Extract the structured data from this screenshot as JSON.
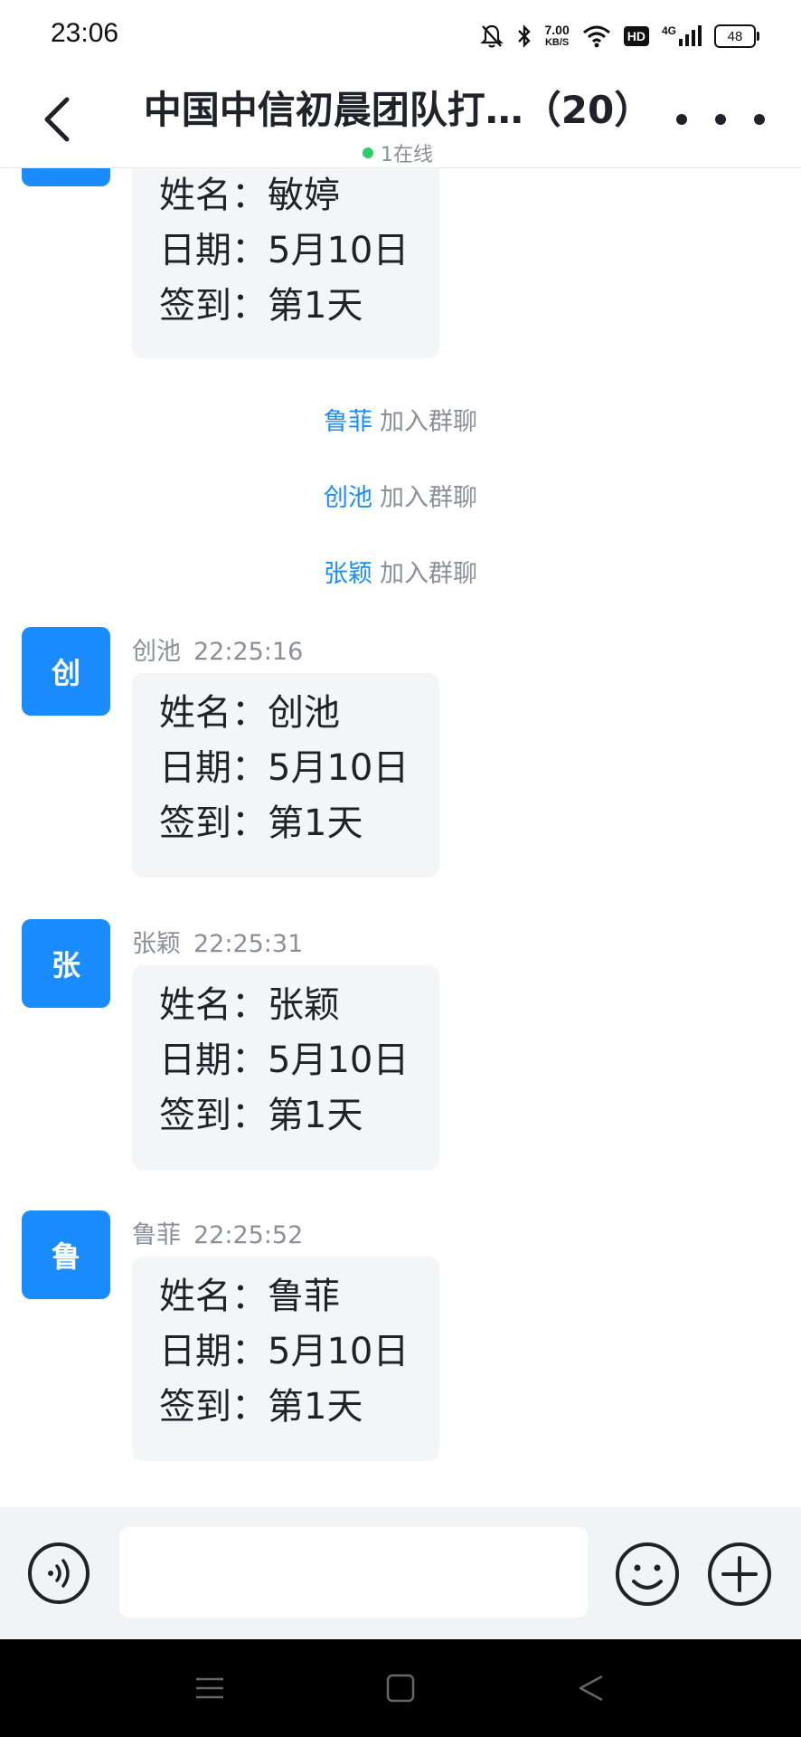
{
  "status_bar": {
    "time": "23:06",
    "speed_value": "7.00",
    "speed_unit": "KB/S",
    "hd_label": "HD",
    "network_label": "4G",
    "battery": "48",
    "icons": [
      "mute-bell-icon",
      "bluetooth-icon",
      "wifi-icon",
      "signal-icon",
      "battery-icon"
    ]
  },
  "header": {
    "title": "中国中信初晨团队打…（20）",
    "online_status": "1在线",
    "online_dot_color": "#2fcd6b"
  },
  "messages": [
    {
      "type": "message",
      "avatar_char": "",
      "sender": "",
      "time": "",
      "lines": [
        "姓名：敏婷",
        "日期：5月10日",
        "签到：第1天"
      ]
    },
    {
      "type": "system",
      "who": "鲁菲",
      "text": "加入群聊"
    },
    {
      "type": "system",
      "who": "创池",
      "text": "加入群聊"
    },
    {
      "type": "system",
      "who": "张颖",
      "text": "加入群聊"
    },
    {
      "type": "message",
      "avatar_char": "创",
      "sender": "创池",
      "time": "22:25:16",
      "lines": [
        "姓名：创池",
        "日期：5月10日",
        "签到：第1天"
      ]
    },
    {
      "type": "message",
      "avatar_char": "张",
      "sender": "张颖",
      "time": "22:25:31",
      "lines": [
        "姓名：张颖",
        "日期：5月10日",
        "签到：第1天"
      ]
    },
    {
      "type": "message",
      "avatar_char": "鲁",
      "sender": "鲁菲",
      "time": "22:25:52",
      "lines": [
        "姓名：鲁菲",
        "日期：5月10日",
        "签到：第1天"
      ]
    }
  ],
  "input_bar": {
    "placeholder": "",
    "icons": [
      "voice-icon",
      "emoji-icon",
      "plus-icon"
    ]
  },
  "colors": {
    "accent": "#1a8cff",
    "bubble": "#f4f5f7",
    "input_bar": "#f2f3f5"
  }
}
